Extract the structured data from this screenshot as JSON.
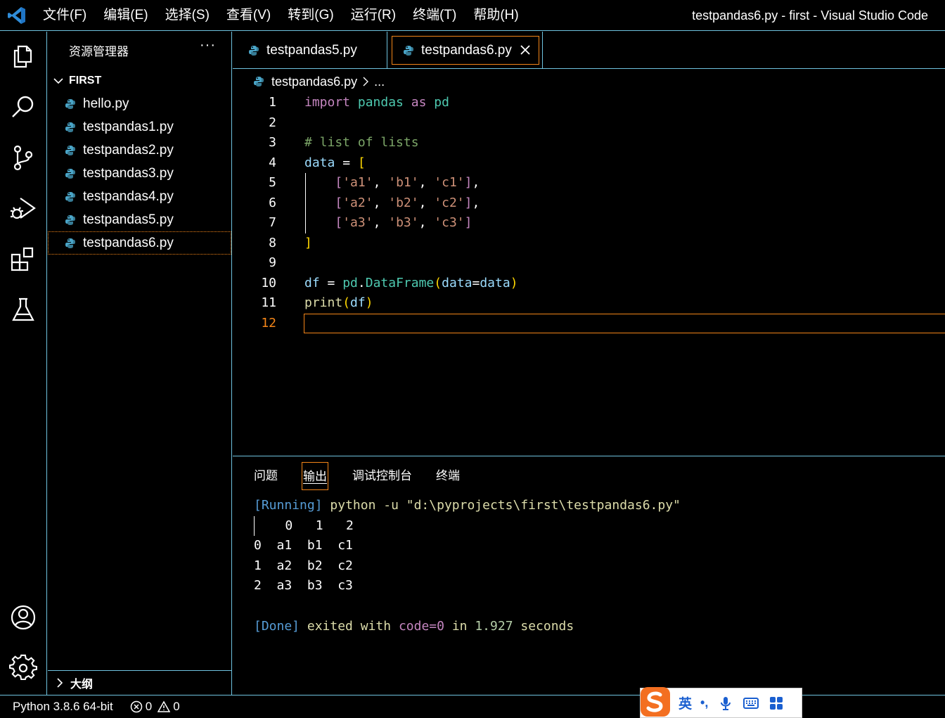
{
  "titlebar": {
    "menu": [
      "文件(F)",
      "编辑(E)",
      "选择(S)",
      "查看(V)",
      "转到(G)",
      "运行(R)",
      "终端(T)",
      "帮助(H)"
    ],
    "window_title": "testpandas6.py - first - Visual Studio Code"
  },
  "activity_bar": {
    "icons": [
      "explorer-icon",
      "search-icon",
      "source-control-icon",
      "run-debug-icon",
      "extensions-icon",
      "testing-icon",
      "account-icon",
      "settings-gear-icon"
    ]
  },
  "sidebar": {
    "title": "资源管理器",
    "more": "···",
    "folder": "FIRST",
    "files": [
      "hello.py",
      "testpandas1.py",
      "testpandas2.py",
      "testpandas3.py",
      "testpandas4.py",
      "testpandas5.py",
      "testpandas6.py"
    ],
    "active_file": "testpandas6.py",
    "outline": "大纲"
  },
  "tabs": [
    {
      "label": "testpandas5.py",
      "active": false
    },
    {
      "label": "testpandas6.py",
      "active": true
    }
  ],
  "breadcrumb": {
    "file": "testpandas6.py",
    "rest": "..."
  },
  "code": {
    "line_numbers": [
      "1",
      "2",
      "3",
      "4",
      "5",
      "6",
      "7",
      "8",
      "9",
      "10",
      "11",
      "12"
    ],
    "current_line": 12,
    "lines": [
      "import pandas as pd",
      "",
      "# list of lists",
      "data = [",
      "    ['a1', 'b1', 'c1'],",
      "    ['a2', 'b2', 'c2'],",
      "    ['a3', 'b3', 'c3']",
      "]",
      "",
      "df = pd.DataFrame(data=data)",
      "print(df)",
      ""
    ]
  },
  "panel": {
    "tabs": [
      "问题",
      "输出",
      "调试控制台",
      "终端"
    ],
    "active_tab": "输出",
    "output": {
      "running_tag": "[Running]",
      "command": "python -u \"d:\\pyprojects\\first\\testpandas6.py\"",
      "table_lines": [
        "    0   1   2",
        "0  a1  b1  c1",
        "1  a2  b2  c2",
        "2  a3  b3  c3"
      ],
      "done_tag": "[Done]",
      "exited_with": "exited with",
      "code": "code=0",
      "in": "in",
      "seconds_value": "1.927",
      "seconds": "seconds"
    }
  },
  "statusbar": {
    "interpreter": "Python 3.8.6 64-bit",
    "errors": "0",
    "warnings": "0"
  },
  "ime": {
    "lang": "英",
    "punct": "•,"
  },
  "colors": {
    "border": "#6fc3df",
    "focus": "#f38518",
    "background": "#000000"
  }
}
